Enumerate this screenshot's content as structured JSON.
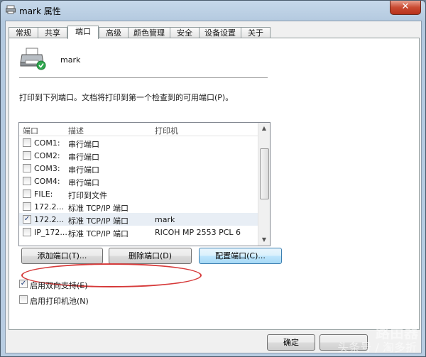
{
  "window": {
    "title": "mark 属性",
    "close_label": "✕"
  },
  "tabs": [
    "常规",
    "共享",
    "端口",
    "高级",
    "颜色管理",
    "安全",
    "设备设置",
    "关于"
  ],
  "printer": {
    "name": "mark"
  },
  "description": "打印到下列端口。文档将打印到第一个检查到的可用端口(P)。",
  "port_list": {
    "headers": [
      "端口",
      "描述",
      "打印机"
    ],
    "rows": [
      {
        "checked": false,
        "port": "COM1:",
        "desc": "串行端口",
        "printer": ""
      },
      {
        "checked": false,
        "port": "COM2:",
        "desc": "串行端口",
        "printer": ""
      },
      {
        "checked": false,
        "port": "COM3:",
        "desc": "串行端口",
        "printer": ""
      },
      {
        "checked": false,
        "port": "COM4:",
        "desc": "串行端口",
        "printer": ""
      },
      {
        "checked": false,
        "port": "FILE:",
        "desc": "打印到文件",
        "printer": ""
      },
      {
        "checked": false,
        "port": "172.2...",
        "desc": "标准 TCP/IP 端口",
        "printer": ""
      },
      {
        "checked": true,
        "port": "172.2...",
        "desc": "标准 TCP/IP 端口",
        "printer": "mark"
      },
      {
        "checked": false,
        "port": "IP_172...",
        "desc": "标准 TCP/IP 端口",
        "printer": "RICOH MP 2553 PCL 6"
      }
    ]
  },
  "buttons": {
    "add_port": "添加端口(T)...",
    "delete_port": "删除端口(D)",
    "configure_port": "配置端口(C)..."
  },
  "options": {
    "bidirectional": {
      "label": "启用双向支持(E)",
      "checked": true
    },
    "pooling": {
      "label": "启用打印机池(N)",
      "checked": false
    }
  },
  "footer": {
    "ok_label": "确定"
  },
  "watermark": {
    "line1": "路由器",
    "line2": "头条号 / 淘多折"
  },
  "colors": {
    "highlight_ellipse": "#d63a3a",
    "focused_button": "#a7d9f5"
  }
}
